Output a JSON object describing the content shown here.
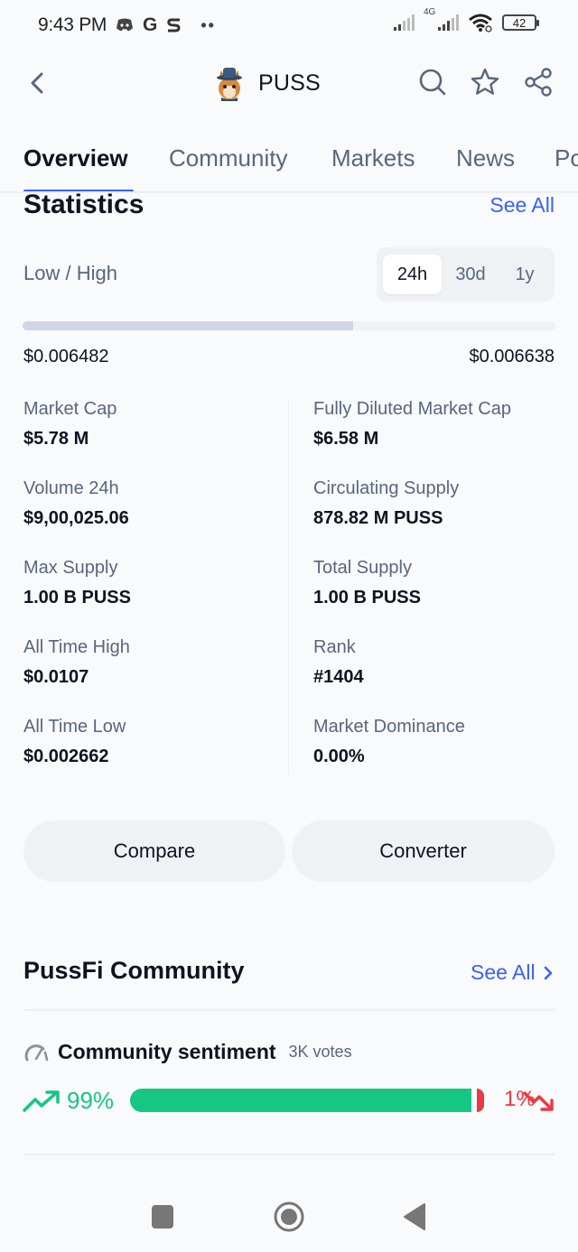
{
  "status_bar": {
    "time": "9:43 PM",
    "app_icons": [
      "discord-icon",
      "google-icon",
      "swiggy-icon"
    ],
    "more_indicator": "••",
    "network_label": "4G",
    "battery_level": "42"
  },
  "header": {
    "title": "PUSS",
    "icons": [
      "back-icon",
      "coin-logo",
      "search-icon",
      "star-icon",
      "share-icon"
    ]
  },
  "tabs": [
    {
      "label": "Overview",
      "active": true
    },
    {
      "label": "Community",
      "active": false
    },
    {
      "label": "Markets",
      "active": false
    },
    {
      "label": "News",
      "active": false
    },
    {
      "label": "Portfolio",
      "active": false
    }
  ],
  "statistics": {
    "title": "Statistics",
    "see_all": "See All",
    "low_high_label": "Low / High",
    "periods": [
      {
        "label": "24h",
        "active": true
      },
      {
        "label": "30d",
        "active": false
      },
      {
        "label": "1y",
        "active": false
      }
    ],
    "range_position_percent": 62,
    "low": "$0.006482",
    "high": "$0.006638",
    "items": [
      {
        "label": "Market Cap",
        "value": "$5.78 M"
      },
      {
        "label": "Fully Diluted Market Cap",
        "value": "$6.58 M"
      },
      {
        "label": "Volume 24h",
        "value": "$9,00,025.06"
      },
      {
        "label": "Circulating Supply",
        "value": "878.82 M PUSS"
      },
      {
        "label": "Max Supply",
        "value": "1.00 B PUSS"
      },
      {
        "label": "Total Supply",
        "value": "1.00 B PUSS"
      },
      {
        "label": "All Time High",
        "value": "$0.0107"
      },
      {
        "label": "Rank",
        "value": "#1404"
      },
      {
        "label": "All Time Low",
        "value": "$0.002662"
      },
      {
        "label": "Market Dominance",
        "value": "0.00%"
      }
    ]
  },
  "actions": {
    "compare": "Compare",
    "converter": "Converter"
  },
  "community": {
    "title": "PussFi Community",
    "see_all": "See All",
    "sentiment_title": "Community sentiment",
    "votes": "3K votes",
    "bullish_percent": 99,
    "bullish_label": "99%",
    "bearish_percent": 1,
    "bearish_label": "1%",
    "colors": {
      "bullish": "#16c784",
      "bearish": "#ea3943"
    }
  },
  "accent_color": "#3861fb"
}
